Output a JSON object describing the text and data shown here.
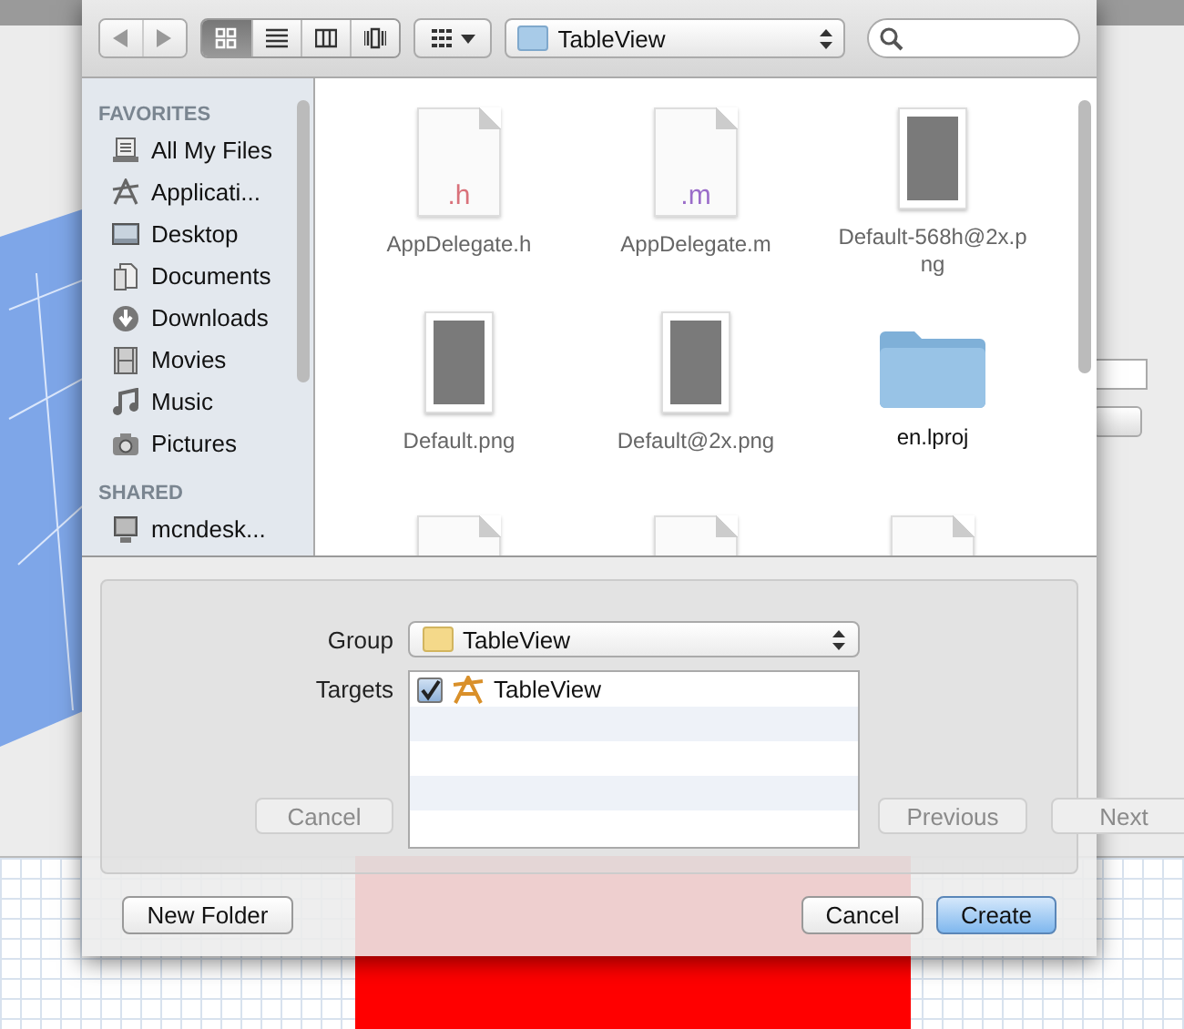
{
  "background_window": {
    "buttons": [
      {
        "label": "Cancel",
        "kind": "cancel"
      },
      {
        "label": "Previous",
        "kind": "previous"
      },
      {
        "label": "Next",
        "kind": "next"
      }
    ]
  },
  "dialog": {
    "toolbar": {
      "view_modes": [
        {
          "kind": "icons",
          "selected": true
        },
        {
          "kind": "list",
          "selected": false
        },
        {
          "kind": "columns",
          "selected": false
        },
        {
          "kind": "coverflow",
          "selected": false
        }
      ],
      "location": "TableView"
    },
    "sidebar": [
      {
        "title": "FAVORITES",
        "items": [
          {
            "label": "All My Files",
            "kind": "files"
          },
          {
            "label": "Applicati...",
            "kind": "apps"
          },
          {
            "label": "Desktop",
            "kind": "desktop"
          },
          {
            "label": "Documents",
            "kind": "documents"
          },
          {
            "label": "Downloads",
            "kind": "downloads"
          },
          {
            "label": "Movies",
            "kind": "movies"
          },
          {
            "label": "Music",
            "kind": "music"
          },
          {
            "label": "Pictures",
            "kind": "pictures"
          }
        ]
      },
      {
        "title": "SHARED",
        "items": [
          {
            "label": "mcndesk...",
            "kind": "computer"
          }
        ]
      }
    ],
    "files": [
      {
        "name": "AppDelegate.h",
        "kind": "header",
        "badge": ".h"
      },
      {
        "name": "AppDelegate.m",
        "kind": "source",
        "badge": ".m"
      },
      {
        "name": "Default-568h@2x.png",
        "kind": "image"
      },
      {
        "name": "Default.png",
        "kind": "image"
      },
      {
        "name": "Default@2x.png",
        "kind": "image"
      },
      {
        "name": "en.lproj",
        "kind": "folder"
      },
      {
        "kind": "document"
      },
      {
        "kind": "document"
      },
      {
        "kind": "document"
      }
    ],
    "group": {
      "label": "Group",
      "value": "TableView"
    },
    "targets": {
      "label": "Targets",
      "rows": [
        {
          "name": "TableView",
          "checked": true
        }
      ]
    },
    "buttons": [
      {
        "label": "New Folder",
        "kind": "secondary"
      },
      {
        "label": "Cancel",
        "kind": "cancel"
      },
      {
        "label": "Create",
        "kind": "default"
      }
    ]
  }
}
